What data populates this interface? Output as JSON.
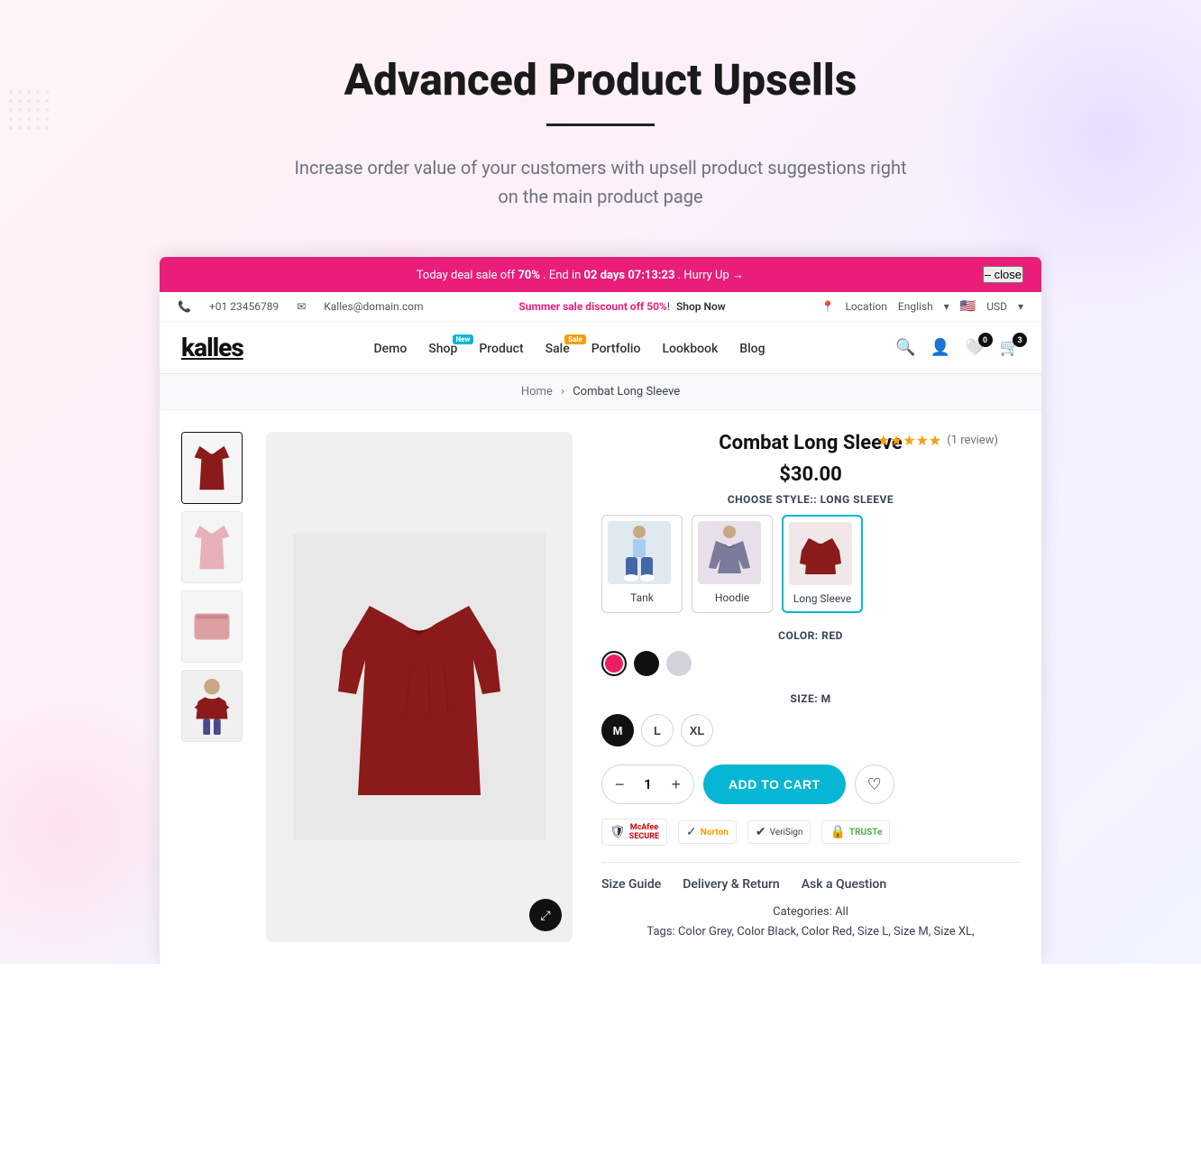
{
  "hero": {
    "title": "Advanced Product Upsells",
    "subtitle": "Increase order value of your customers with upsell product suggestions right on the main product page"
  },
  "announcement": {
    "text_before": "Today deal sale off ",
    "discount": "70%",
    "text_middle": " . End in ",
    "countdown": "02 days 07:13:23",
    "text_after": ". Hurry Up →",
    "close_label": "– close"
  },
  "topbar": {
    "phone": "+01 23456789",
    "email": "Kalles@domain.com",
    "summer_text": "Summer sale discount off ",
    "summer_discount": "50%",
    "shop_now": "Shop Now",
    "location": "Location",
    "language": "English",
    "currency": "USD"
  },
  "nav": {
    "logo": "kalles",
    "links": [
      {
        "label": "Demo",
        "badge": null
      },
      {
        "label": "Shop",
        "badge": "New"
      },
      {
        "label": "Product",
        "badge": null
      },
      {
        "label": "Sale",
        "badge": "Sale"
      },
      {
        "label": "Portfolio",
        "badge": null
      },
      {
        "label": "Lookbook",
        "badge": null
      },
      {
        "label": "Blog",
        "badge": null
      }
    ],
    "wishlist_count": "0",
    "cart_count": "3"
  },
  "breadcrumb": {
    "home": "Home",
    "current": "Combat Long Sleeve"
  },
  "product": {
    "name": "Combat Long Sleeve",
    "price": "$30.00",
    "rating_stars": 5,
    "review_count": "(1 review)",
    "style_label": "CHOOSE STYLE:: LONG SLEEVE",
    "styles": [
      {
        "name": "Tank"
      },
      {
        "name": "Hoodie"
      },
      {
        "name": "Long Sleeve"
      }
    ],
    "color_label": "COLOR: RED",
    "colors": [
      "red",
      "black",
      "grey"
    ],
    "selected_color": "red",
    "size_label": "SIZE: M",
    "sizes": [
      "M",
      "L",
      "XL"
    ],
    "selected_size": "M",
    "qty": "1",
    "add_to_cart_label": "ADD TO CART",
    "tabs": [
      {
        "label": "Size Guide"
      },
      {
        "label": "Delivery & Return"
      },
      {
        "label": "Ask a Question"
      }
    ],
    "categories_label": "Categories:",
    "categories_value": "All",
    "tags_label": "Tags:",
    "tags_value": "Color Grey, Color Black, Color Red, Size L, Size M, Size XL,"
  }
}
